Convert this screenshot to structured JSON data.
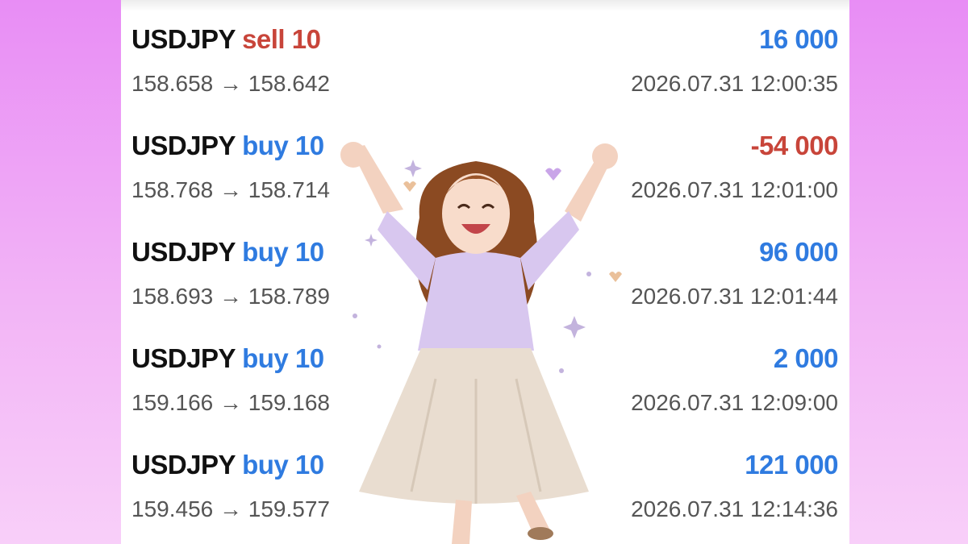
{
  "trades": [
    {
      "symbol": "USDJPY",
      "side": "sell",
      "volume": "sell 10",
      "prices": "158.658 → 158.642",
      "profit": "16 000",
      "profit_sign": "positive",
      "time": "2026.07.31 12:00:35"
    },
    {
      "symbol": "USDJPY",
      "side": "buy",
      "volume": "buy 10",
      "prices": "158.768 → 158.714",
      "profit": "-54 000",
      "profit_sign": "negative",
      "time": "2026.07.31 12:01:00"
    },
    {
      "symbol": "USDJPY",
      "side": "buy",
      "volume": "buy 10",
      "prices": "158.693 → 158.789",
      "profit": "96 000",
      "profit_sign": "positive",
      "time": "2026.07.31 12:01:44"
    },
    {
      "symbol": "USDJPY",
      "side": "buy",
      "volume": "buy 10",
      "prices": "159.166 → 159.168",
      "profit": "2 000",
      "profit_sign": "positive",
      "time": "2026.07.31 12:09:00"
    },
    {
      "symbol": "USDJPY",
      "side": "buy",
      "volume": "buy 10",
      "prices": "159.456 → 159.577",
      "profit": "121 000",
      "profit_sign": "positive",
      "time": "2026.07.31 12:14:36"
    }
  ],
  "colors": {
    "buy": "#2f7be0",
    "sell": "#c8453a",
    "profit_positive": "#2f7be0",
    "profit_negative": "#c8453a",
    "background": "#e88df5"
  },
  "illustration": "cheering-woman-illustration"
}
